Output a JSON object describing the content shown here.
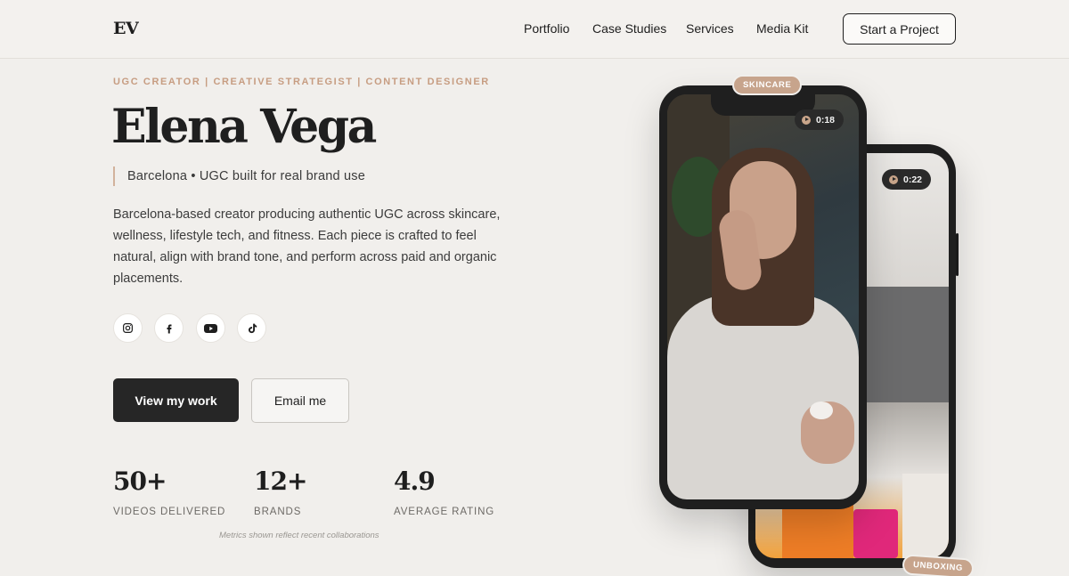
{
  "header": {
    "logo": "EV",
    "nav": [
      "Portfolio",
      "Case Studies",
      "Services",
      "Media Kit"
    ],
    "cta": "Start a Project"
  },
  "hero": {
    "eyebrow": "UGC CREATOR | CREATIVE STRATEGIST | CONTENT DESIGNER",
    "name": "Elena Vega",
    "tagline": "Barcelona • UGC built for real brand use",
    "description": "Barcelona-based creator producing authentic UGC across skincare, wellness, lifestyle tech, and fitness. Each piece is crafted to feel natural, align with brand tone, and perform across paid and organic placements.",
    "socials": [
      "instagram-icon",
      "facebook-icon",
      "youtube-icon",
      "tiktok-icon"
    ],
    "primary_button": "View my work",
    "secondary_button": "Email me"
  },
  "stats": [
    {
      "value": "50+",
      "label": "VIDEOS DELIVERED"
    },
    {
      "value": "12+",
      "label": "BRANDS"
    },
    {
      "value": "4.9",
      "label": "AVERAGE RATING"
    }
  ],
  "metrics_note": "Metrics shown reflect recent collaborations",
  "phones": {
    "front": {
      "tag": "SKINCARE",
      "duration": "0:18"
    },
    "back": {
      "tag": "UNBOXING",
      "duration": "0:22"
    }
  },
  "colors": {
    "background": "#f1efec",
    "accent": "#c7a48c",
    "dark": "#262626"
  }
}
